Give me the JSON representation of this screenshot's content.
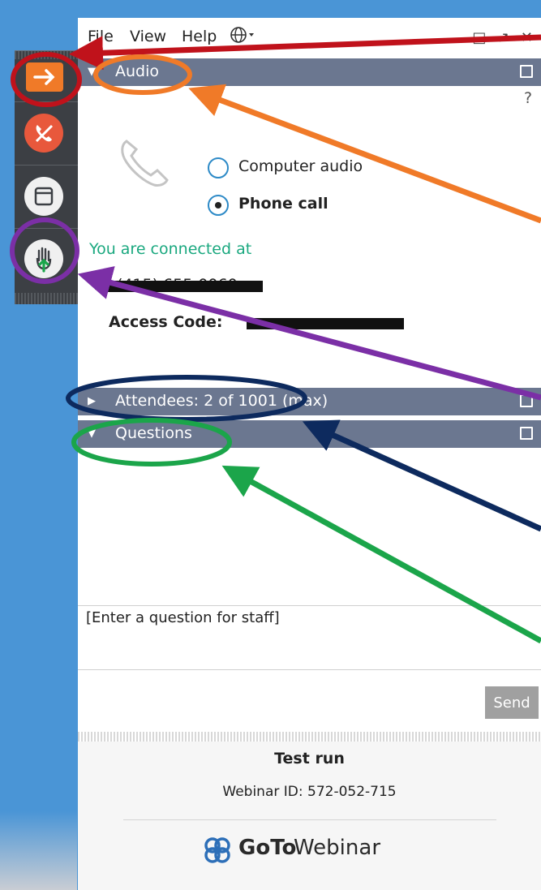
{
  "menubar": {
    "file": "File",
    "view": "View",
    "help": "Help",
    "globe_icon": "globe-icon",
    "window_controls": "□ ↗ ✕"
  },
  "toolbar": {
    "buttons": [
      {
        "name": "collapse-panel-button",
        "icon": "arrow-right-icon",
        "color": "#f07a28"
      },
      {
        "name": "leave-audio-button",
        "icon": "phone-hangup-icon",
        "color": "#e8583c"
      },
      {
        "name": "screen-view-button",
        "icon": "window-icon",
        "color": "#f0f0f0"
      },
      {
        "name": "raise-hand-button",
        "icon": "hand-icon",
        "color": "#f0f0f0"
      }
    ]
  },
  "audio": {
    "title": "Audio",
    "help": "?",
    "option_computer": "Computer audio",
    "option_phone": "Phone call",
    "selected": "Phone call",
    "connected_label": "You are connected at",
    "phone_number": "+1 (415) 655-0060",
    "access_code_label": "Access Code:"
  },
  "attendees": {
    "title": "Attendees:  2 of 1001 (max)"
  },
  "questions": {
    "title": "Questions",
    "input_placeholder": "[Enter a question for staff]",
    "send_label": "Send"
  },
  "footer": {
    "session_title": "Test run",
    "webinar_id": "Webinar ID: 572-052-715",
    "brand_bold": "GoTo",
    "brand_light": "Webinar"
  },
  "colors": {
    "accent_orange": "#f07a28",
    "section_header": "#6b7790",
    "connected_text": "#1aa87f",
    "annotation_red": "#c0121b",
    "annotation_orange": "#f07a28",
    "annotation_purple": "#7b2fa6",
    "annotation_navy": "#0d2a5e",
    "annotation_green": "#1ba54a"
  }
}
